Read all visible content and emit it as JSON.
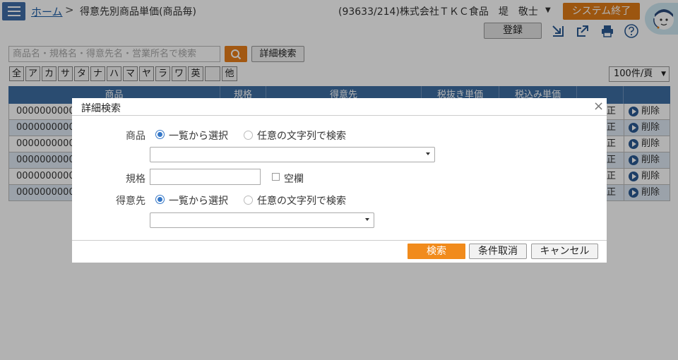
{
  "header": {
    "home_link": "ホーム",
    "separator": ">",
    "page_title": "得意先別商品単価(商品毎)",
    "user_info": "(93633/214)株式会社ＴＫＣ食品　堤　敬士",
    "user_caret": "▼",
    "exit_label": "システム終了"
  },
  "toolbar": {
    "register_label": "登録",
    "icons": [
      "import-icon",
      "export-icon",
      "print-icon",
      "help-icon"
    ]
  },
  "search": {
    "placeholder": "商品名・規格名・得意先名・営業所名で検索",
    "advanced_label": "詳細検索"
  },
  "kana_filters": [
    "全",
    "ア",
    "カ",
    "サ",
    "タ",
    "ナ",
    "ハ",
    "マ",
    "ヤ",
    "ラ",
    "ワ",
    "英",
    "",
    "他"
  ],
  "per_page": {
    "value": "100件/頁",
    "caret": "▼"
  },
  "table": {
    "columns": [
      "商品",
      "規格",
      "得意先",
      "税抜き単価",
      "税込み単価",
      "",
      ""
    ],
    "rows": [
      {
        "code": "000000000000",
        "edit": "正",
        "delete": "削除"
      },
      {
        "code": "000000000000",
        "edit": "正",
        "delete": "削除"
      },
      {
        "code": "000000000000",
        "edit": "正",
        "delete": "削除"
      },
      {
        "code": "000000000000",
        "edit": "正",
        "delete": "削除"
      },
      {
        "code": "000000000000",
        "edit": "正",
        "delete": "削除"
      },
      {
        "code": "000000000000",
        "edit": "正",
        "delete": "削除"
      }
    ]
  },
  "dialog": {
    "title": "詳細検索",
    "close": "×",
    "product": {
      "label": "商品",
      "option_list": "一覧から選択",
      "option_text": "任意の文字列で検索",
      "selected": "list",
      "value": ""
    },
    "spec": {
      "label": "規格",
      "value": "",
      "blank_label": "空欄",
      "blank_checked": false
    },
    "customer": {
      "label": "得意先",
      "option_list": "一覧から選択",
      "option_text": "任意の文字列で検索",
      "selected": "list",
      "value": ""
    },
    "buttons": {
      "search": "検索",
      "clear": "条件取消",
      "cancel": "キャンセル"
    }
  },
  "colors": {
    "header_blue": "#3d6ea3",
    "accent_orange": "#e87e1b",
    "radio_blue": "#3577c7"
  }
}
